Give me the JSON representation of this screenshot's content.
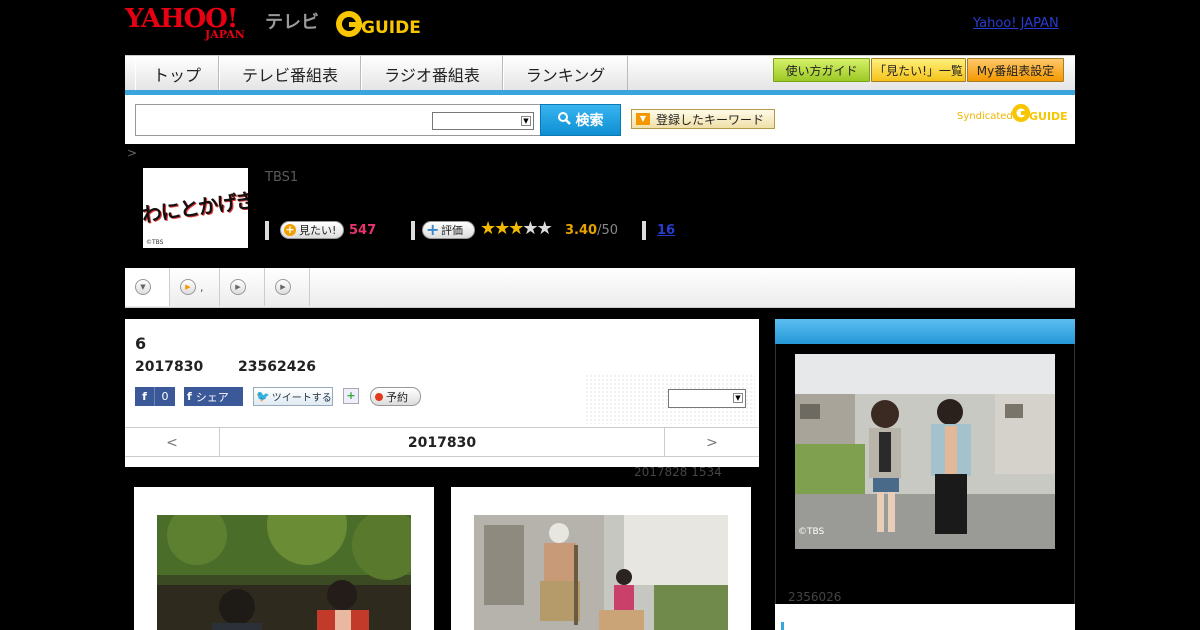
{
  "header": {
    "logo_yahoo": "YAHOO!",
    "logo_japan": "JAPAN",
    "logo_tv": "テレビ",
    "logo_gguide": "GUIDE",
    "yahoo_japan_link": "Yahoo! JAPAN"
  },
  "nav": {
    "tabs": [
      "トップ",
      "テレビ番組表",
      "ラジオ番組表",
      "ランキング"
    ],
    "right_buttons": [
      "使い方ガイド",
      "「見たい!」一覧",
      "My番組表設定"
    ]
  },
  "search": {
    "button_label": "検索",
    "keyword_button_label": "登録したキーワード",
    "syndicated_label": "Syndicated",
    "syndicated_logo": "GUIDE"
  },
  "breadcrumb_separator": ">",
  "program": {
    "thumbnail_text": "わにとかげぎす",
    "thumbnail_copyright": "©TBS",
    "channel": "TBS1",
    "want_to_see_label": "見たい!",
    "want_to_see_count": "547",
    "rate_label": "評価",
    "rating_value": "3.40",
    "rating_max": "/50",
    "review_count": "16",
    "stars_filled": 3
  },
  "tabs": [
    {
      "icon": "chevron-down-icon",
      "label": ""
    },
    {
      "icon": "play-icon",
      "label": ","
    },
    {
      "icon": "play-icon",
      "label": ""
    },
    {
      "icon": "play-icon",
      "label": ""
    }
  ],
  "episode": {
    "number": "6",
    "date": "2017830",
    "time": "23562426",
    "fb_like_count": "0",
    "fb_share_label": "シェア",
    "tweet_label": "ツイートする",
    "reserve_label": "予約",
    "prev_symbol": "<",
    "next_symbol": ">",
    "nav_date": "2017830",
    "updated": "2017828  1534"
  },
  "photos": [
    {
      "name": "episode-photo-1"
    },
    {
      "name": "episode-photo-2"
    }
  ],
  "sidebar": {
    "photo_copyright": "©TBS",
    "caption": "2356026"
  },
  "colors": {
    "accent_blue": "#3aa4dd",
    "yahoo_red": "#e60012",
    "want_pink": "#e8336d",
    "star_yellow": "#f3b800"
  }
}
